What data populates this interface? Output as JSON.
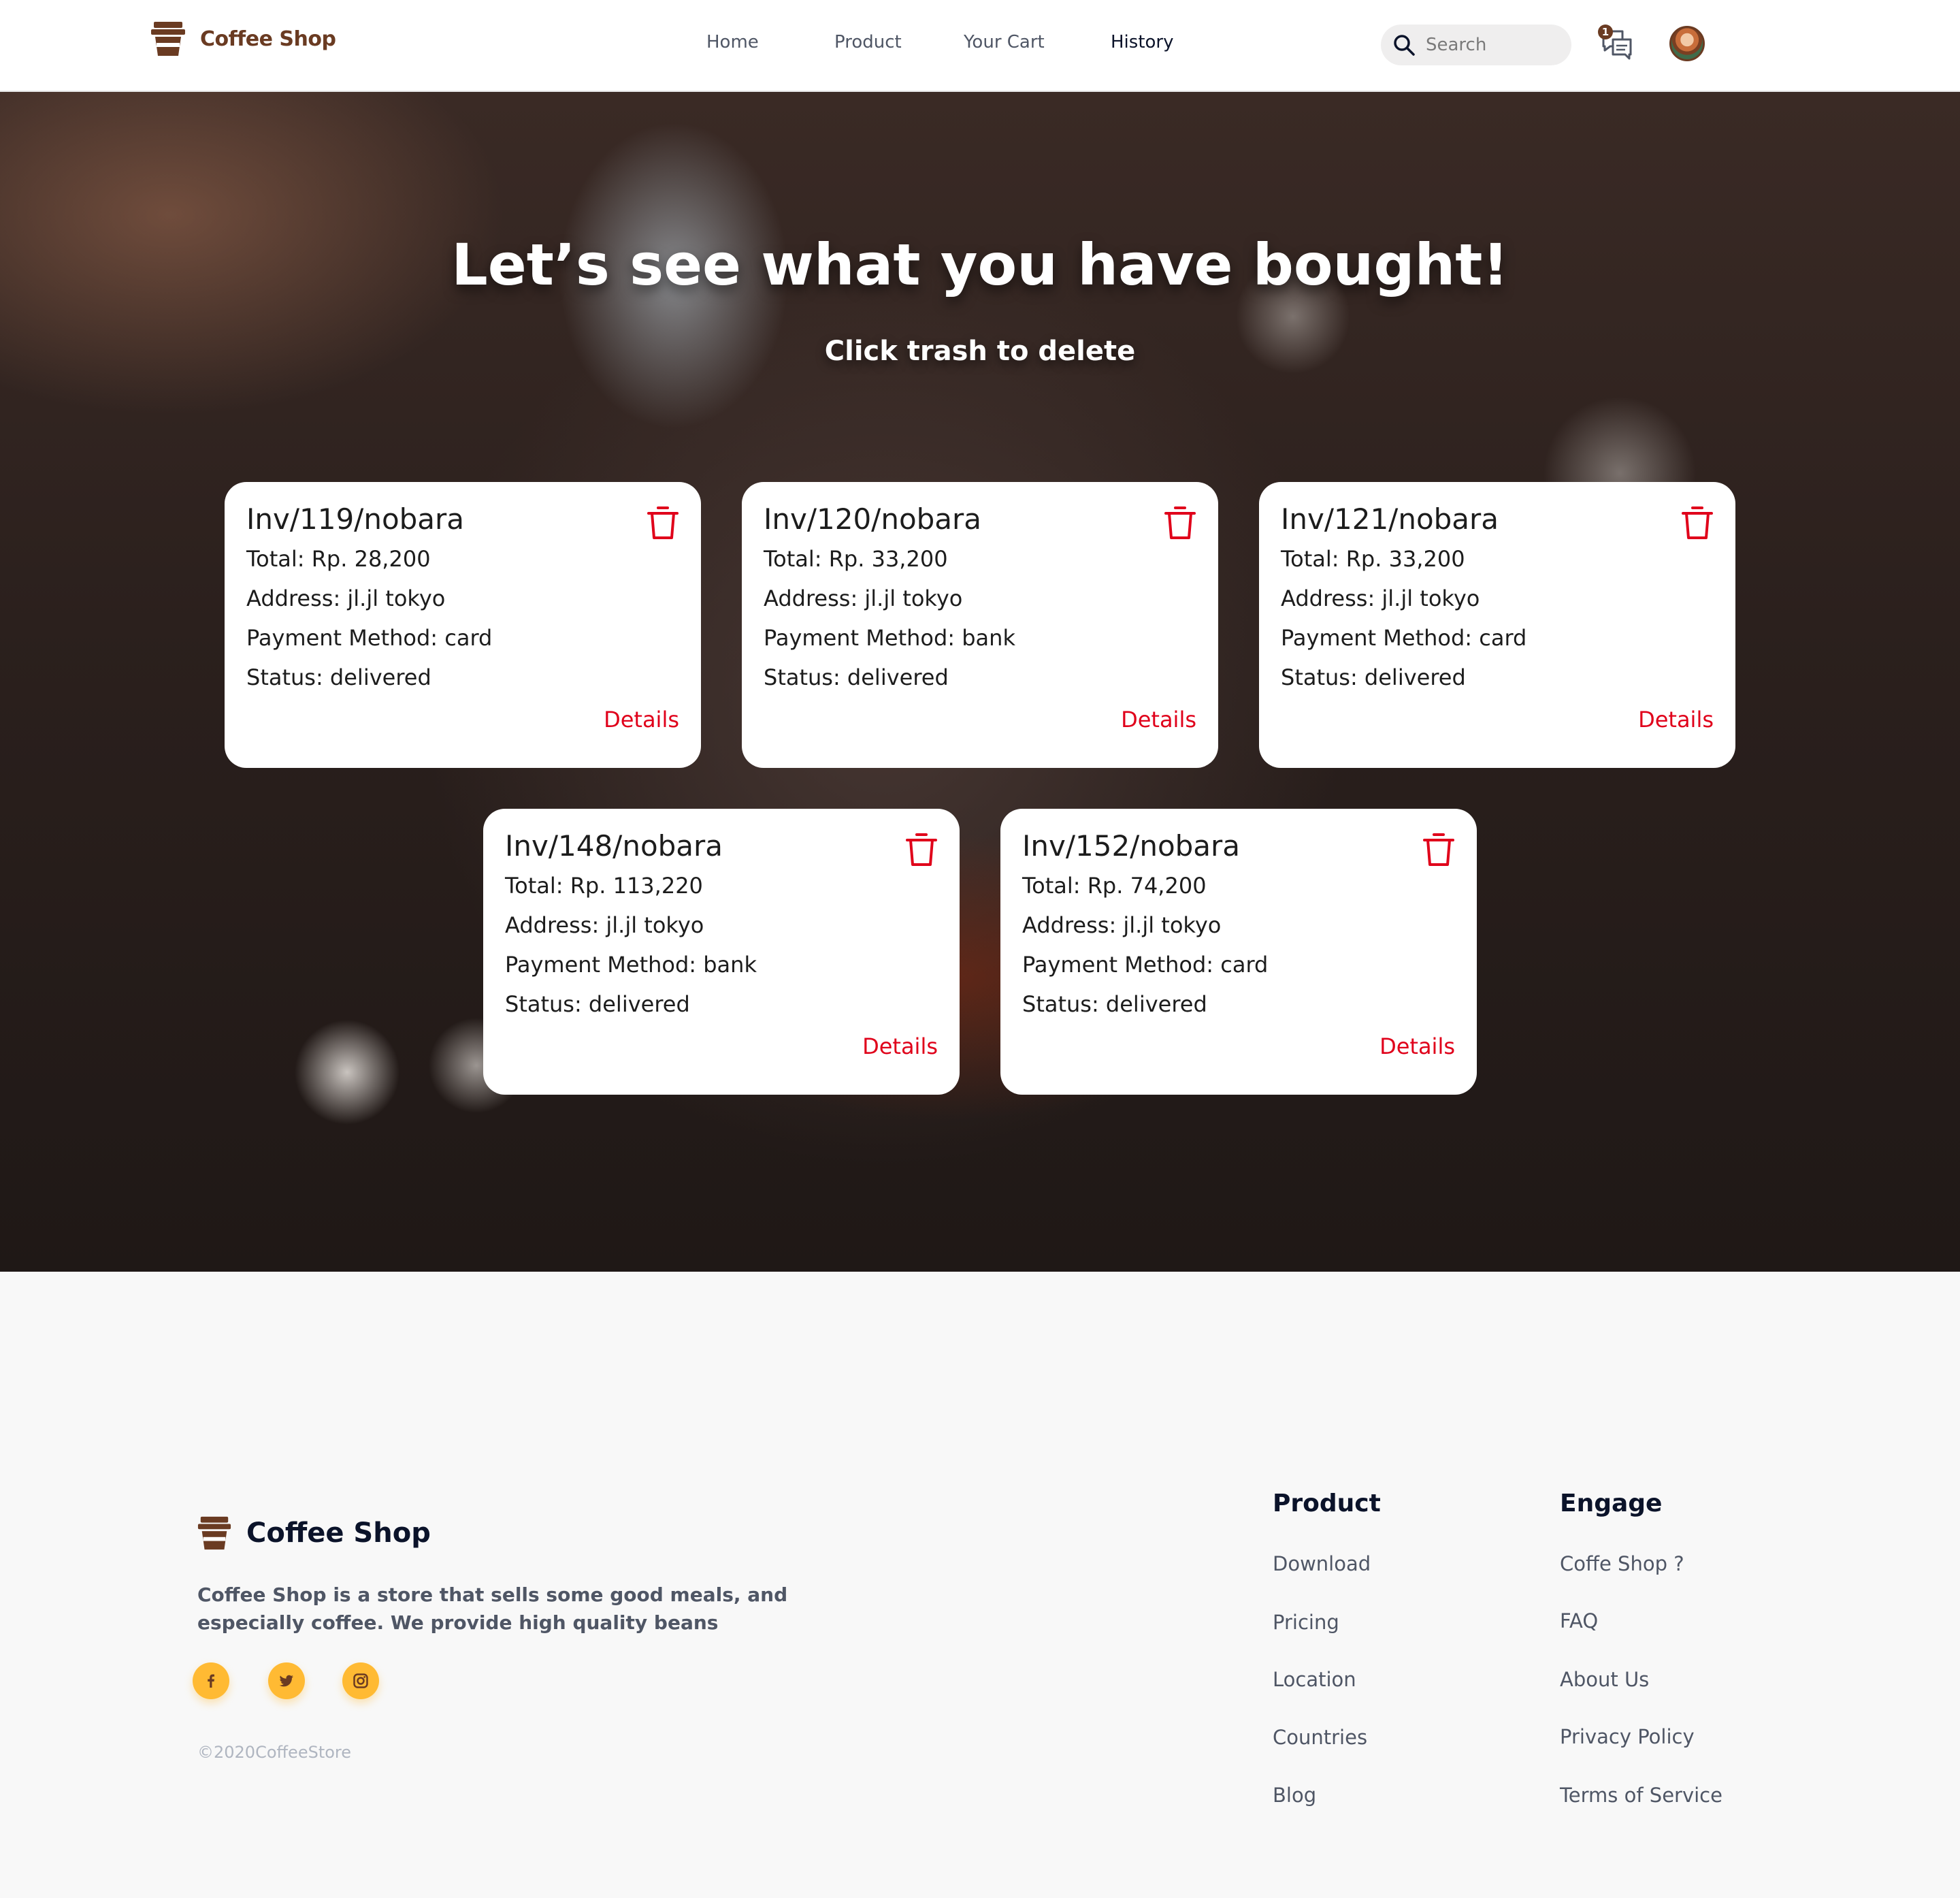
{
  "brand": {
    "name": "Coffee Shop",
    "brand_color": "#6a3b22"
  },
  "nav": {
    "home": "Home",
    "product": "Product",
    "cart": "Your Cart",
    "history": "History",
    "active": "History"
  },
  "search": {
    "placeholder": "Search"
  },
  "chat": {
    "badge": "1"
  },
  "hero": {
    "title": "Let’s see what you have bought!",
    "subtitle": "Click trash to delete"
  },
  "invoices": [
    {
      "title": "Inv/119/nobara",
      "total": "Total: Rp. 28,200",
      "address": "Address: jl.jl tokyo",
      "payment": "Payment Method: card",
      "status": "Status: delivered",
      "details": "Details"
    },
    {
      "title": "Inv/120/nobara",
      "total": "Total: Rp. 33,200",
      "address": "Address: jl.jl tokyo",
      "payment": "Payment Method: bank",
      "status": "Status: delivered",
      "details": "Details"
    },
    {
      "title": "Inv/121/nobara",
      "total": "Total: Rp. 33,200",
      "address": "Address: jl.jl tokyo",
      "payment": "Payment Method: card",
      "status": "Status: delivered",
      "details": "Details"
    },
    {
      "title": "Inv/148/nobara",
      "total": "Total: Rp. 113,220",
      "address": "Address: jl.jl tokyo",
      "payment": "Payment Method: bank",
      "status": "Status: delivered",
      "details": "Details"
    },
    {
      "title": "Inv/152/nobara",
      "total": "Total: Rp. 74,200",
      "address": "Address: jl.jl tokyo",
      "payment": "Payment Method: card",
      "status": "Status: delivered",
      "details": "Details"
    }
  ],
  "footer": {
    "brand_name": "Coffee Shop",
    "description": "Coffee Shop is a store that sells some good meals, and especially coffee. We provide high quality beans",
    "social": [
      "facebook-icon",
      "twitter-icon",
      "instagram-icon"
    ],
    "copyright": "©2020CoffeeStore",
    "product_heading": "Product",
    "product_links": [
      "Download",
      "Pricing",
      "Location",
      "Countries",
      "Blog"
    ],
    "engage_heading": "Engage",
    "engage_links": [
      "Coffe Shop ?",
      "FAQ",
      "About Us",
      "Privacy Policy",
      "Terms of Service"
    ]
  },
  "colors": {
    "accent_red": "#e0001a",
    "social_yellow": "#ffba33",
    "footer_bg": "#f8f8f8"
  }
}
